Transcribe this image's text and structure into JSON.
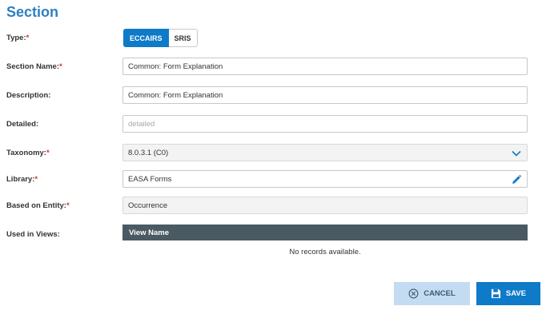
{
  "title": "Section",
  "labels": {
    "type": "Type:",
    "section_name": "Section Name:",
    "description": "Description:",
    "detailed": "Detailed:",
    "taxonomy": "Taxonomy:",
    "library": "Library:",
    "based_on_entity": "Based on Entity:",
    "used_in_views": "Used in Views:",
    "required_marker": "*"
  },
  "type_options": {
    "selected": "ECCAIRS",
    "other": "SRIS"
  },
  "fields": {
    "section_name": "Common: Form Explanation",
    "description": "Common: Form Explanation",
    "detailed_placeholder": "detailed",
    "taxonomy": "8.0.3.1 (C0)",
    "library": "EASA Forms",
    "based_on_entity": "Occurrence"
  },
  "views_table": {
    "column": "View Name",
    "empty_text": "No records available."
  },
  "buttons": {
    "cancel": "CANCEL",
    "save": "SAVE"
  },
  "colors": {
    "accent": "#0e7ac8",
    "title": "#2f7fbf",
    "required": "#d9302c",
    "table_header": "#4a5a63",
    "cancel_bg": "#c3dcf2"
  },
  "icons": {
    "taxonomy": "chevron-down-icon",
    "library": "pencil-icon",
    "cancel": "close-circle-icon",
    "save": "floppy-disk-icon"
  }
}
